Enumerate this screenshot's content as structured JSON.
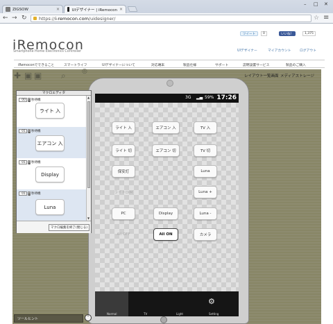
{
  "browser": {
    "tabs": [
      {
        "label": "ZIGSOW",
        "icon": "zigsow-favicon"
      },
      {
        "label": "UIデザイナー | iRemocon",
        "icon": "iremocon-favicon"
      }
    ],
    "url_scheme": "https://",
    "url_domain": "i-remocon.com",
    "url_path": "/uidesigner/"
  },
  "site": {
    "logo": "iRemocon",
    "tagline": "Smartphone Home Electronics Controller",
    "tweet_label": "ツイート",
    "tweet_count": "0",
    "like_label": "いいね！",
    "like_count": "1,375",
    "top_links": [
      "UIデザイナー",
      "マイアカウント",
      "ログアウト"
    ],
    "global_nav": [
      "iRemoconでできること",
      "スマートライフ",
      "UIデザイナーについて",
      "対応端末",
      "製品仕様",
      "サポート",
      "説明設置サービス",
      "製品のご購入"
    ]
  },
  "designer": {
    "right_links": [
      "レイアウト一覧画面",
      "メディアストレージ"
    ],
    "hint_label": "ツールヒント"
  },
  "macro_editor": {
    "title": "マクロエディタ",
    "unit": "秒待機",
    "rows": [
      {
        "wait": "00",
        "button": "ライト 入"
      },
      {
        "wait": "01",
        "button": "エアコン 入"
      },
      {
        "wait": "01",
        "button": "Display"
      },
      {
        "wait": "01",
        "button": "Luna"
      }
    ],
    "close_label": "マクロ編集を終了(閉じる)"
  },
  "phone": {
    "status_signal": "3G",
    "status_battery": "59%",
    "time": "17:26",
    "buttons": [
      {
        "label": "ライト 入"
      },
      {
        "label": "エアコン 入"
      },
      {
        "label": "TV 入"
      },
      {
        "label": "ライト 切"
      },
      {
        "label": "エアコン 切"
      },
      {
        "label": "TV 切"
      },
      {
        "label": "保安灯"
      },
      {
        "label": "Luna"
      },
      {
        "label": "ライトDIM"
      },
      {
        "label": "Luna +"
      },
      {
        "label": "PC"
      },
      {
        "label": "Display"
      },
      {
        "label": "Luna -"
      },
      {
        "label": "All OFF"
      },
      {
        "label": "All ON"
      },
      {
        "label": "カメラ"
      }
    ],
    "tabs": [
      "Normal",
      "TV",
      "Light",
      "Setting"
    ]
  }
}
